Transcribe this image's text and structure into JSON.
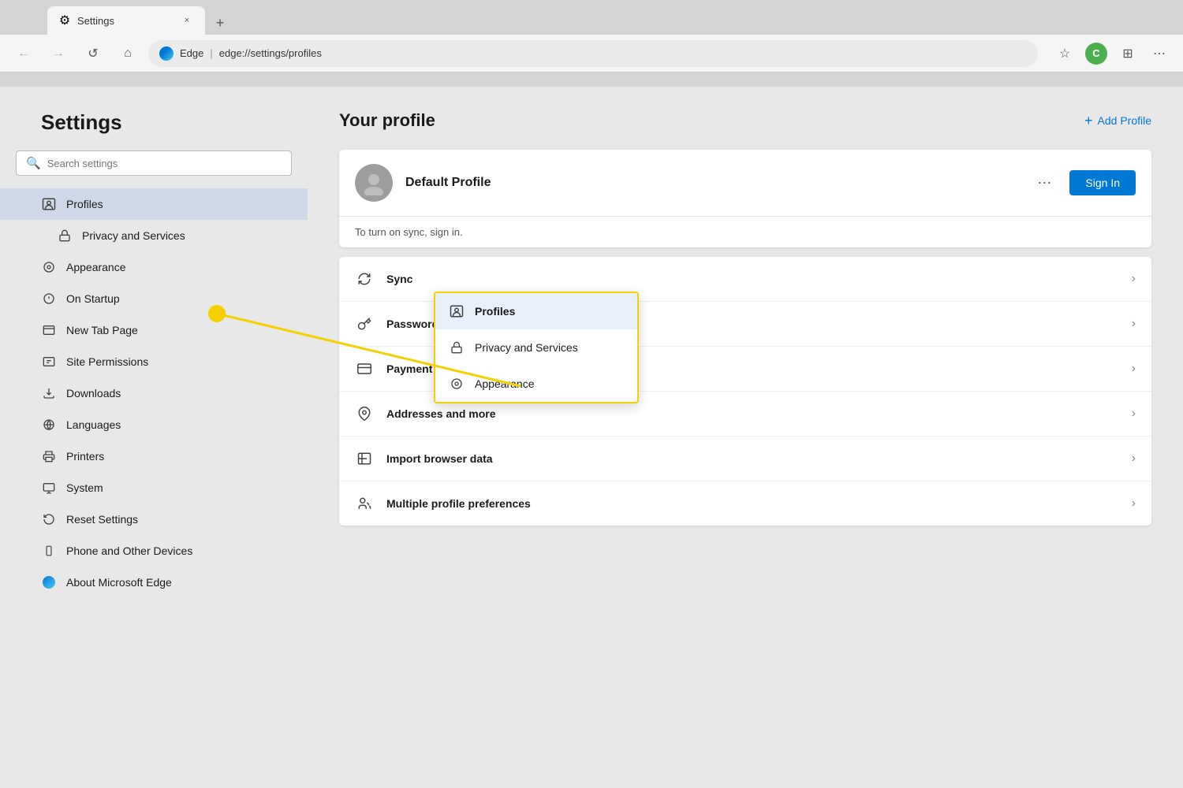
{
  "browser": {
    "tab_title": "Settings",
    "tab_icon": "⚙",
    "new_tab_btn": "+",
    "close_tab_btn": "×",
    "nav": {
      "back_btn": "←",
      "forward_btn": "→",
      "refresh_btn": "↺",
      "home_btn": "⌂",
      "address_brand": "Edge",
      "address_url": "edge://settings/profiles",
      "address_url_scheme": "edge://",
      "address_url_highlight": "settings",
      "address_url_path": "/profiles",
      "favorites_icon": "☆",
      "collections_icon": "⊞",
      "profile_letter": "C",
      "more_icon": "⋯"
    }
  },
  "sidebar": {
    "title": "Settings",
    "search_placeholder": "Search settings",
    "nav_items": [
      {
        "id": "profiles",
        "label": "Profiles",
        "icon": "profiles",
        "active": true
      },
      {
        "id": "privacy",
        "label": "Privacy and Services",
        "icon": "privacy",
        "sub": true
      },
      {
        "id": "appearance",
        "label": "Appearance",
        "icon": "appearance"
      },
      {
        "id": "on-startup",
        "label": "On Startup",
        "icon": "startup"
      },
      {
        "id": "new-tab",
        "label": "New Tab Page",
        "icon": "newtab"
      },
      {
        "id": "site-permissions",
        "label": "Site Permissions",
        "icon": "permissions"
      },
      {
        "id": "downloads",
        "label": "Downloads",
        "icon": "downloads"
      },
      {
        "id": "languages",
        "label": "Languages",
        "icon": "languages"
      },
      {
        "id": "printers",
        "label": "Printers",
        "icon": "printers"
      },
      {
        "id": "system",
        "label": "System",
        "icon": "system"
      },
      {
        "id": "reset",
        "label": "Reset Settings",
        "icon": "reset"
      },
      {
        "id": "phone",
        "label": "Phone and Other Devices",
        "icon": "phone"
      },
      {
        "id": "about",
        "label": "About Microsoft Edge",
        "icon": "about"
      }
    ]
  },
  "content": {
    "page_title": "Your profile",
    "add_profile_label": "Add Profile",
    "profile": {
      "name": "Default Profile",
      "more_icon": "⋯",
      "sign_in_label": "Sign In",
      "sync_notice": "To turn on sync, sign in."
    },
    "settings_items": [
      {
        "id": "sync",
        "label": "Sync",
        "icon": "sync"
      },
      {
        "id": "passwords",
        "label": "Passwords",
        "icon": "key"
      },
      {
        "id": "payment",
        "label": "Payment info",
        "icon": "card"
      },
      {
        "id": "addresses",
        "label": "Addresses and more",
        "icon": "location"
      },
      {
        "id": "import",
        "label": "Import browser data",
        "icon": "import"
      },
      {
        "id": "multiple",
        "label": "Multiple profile preferences",
        "icon": "multiprofile"
      }
    ]
  },
  "tooltip": {
    "items": [
      {
        "id": "profiles",
        "label": "Profiles",
        "icon": "profile-icon",
        "highlighted": true
      },
      {
        "id": "privacy",
        "label": "Privacy and Services",
        "icon": "lock-icon"
      },
      {
        "id": "appearance",
        "label": "Appearance",
        "icon": "appearance-icon"
      }
    ]
  },
  "annotation": {
    "dot_color": "#f5d000",
    "line_color": "#f5d000"
  }
}
